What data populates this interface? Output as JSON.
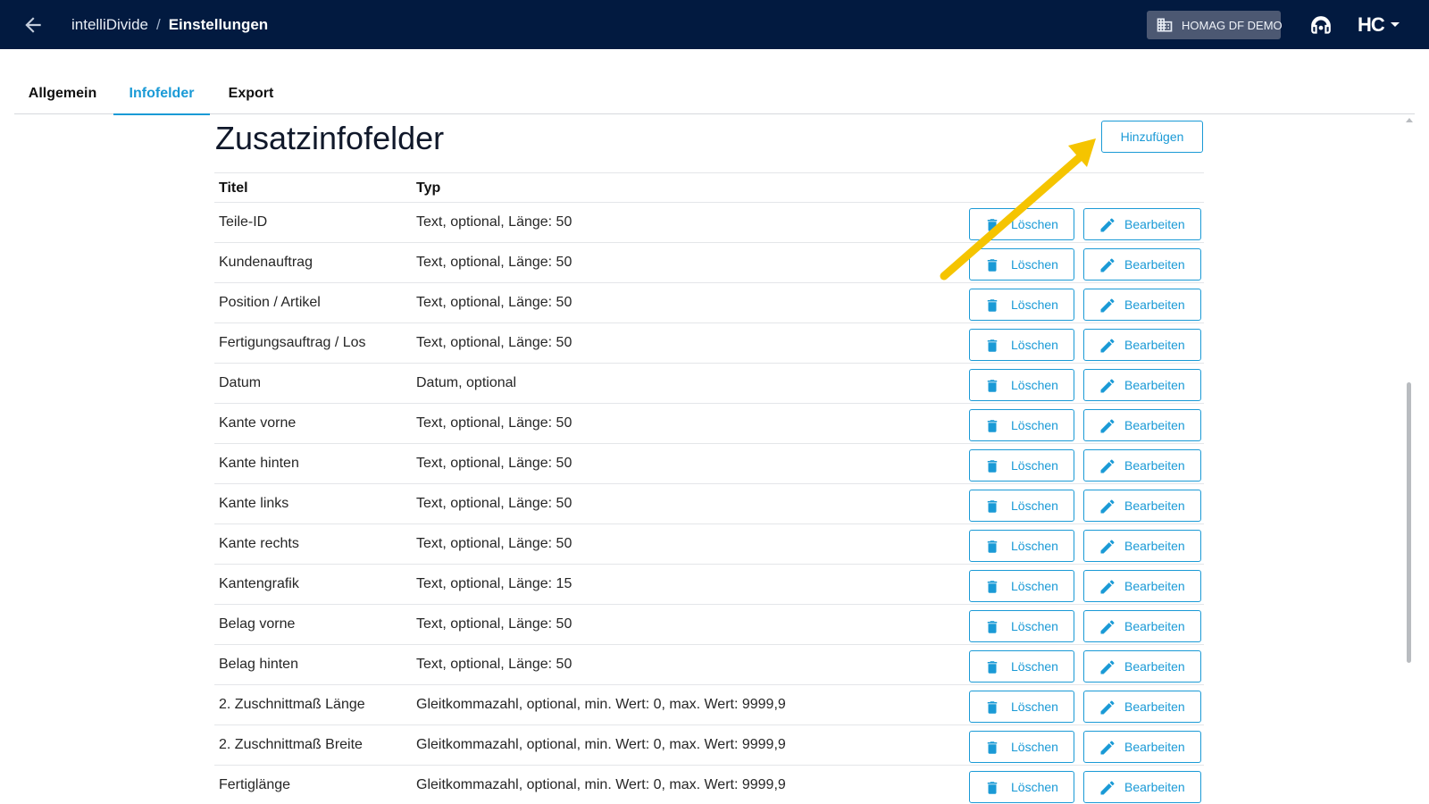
{
  "header": {
    "app_name": "intelliDivide",
    "separator": "/",
    "page_name": "Einstellungen",
    "tenant_label": "HOMAG DF DEMO",
    "app_logo_text": "HC"
  },
  "tabs": [
    {
      "label": "Allgemein",
      "active": false
    },
    {
      "label": "Infofelder",
      "active": true
    },
    {
      "label": "Export",
      "active": false
    }
  ],
  "section": {
    "title": "Zusatzinfofelder",
    "add_label": "Hinzufügen"
  },
  "table": {
    "columns": [
      "Titel",
      "Typ"
    ],
    "delete_label": "Löschen",
    "edit_label": "Bearbeiten",
    "rows": [
      {
        "title": "Teile-ID",
        "type": "Text, optional, Länge: 50"
      },
      {
        "title": "Kundenauftrag",
        "type": "Text, optional, Länge: 50"
      },
      {
        "title": "Position / Artikel",
        "type": "Text, optional, Länge: 50"
      },
      {
        "title": "Fertigungsauftrag / Los",
        "type": "Text, optional, Länge: 50"
      },
      {
        "title": "Datum",
        "type": "Datum, optional"
      },
      {
        "title": "Kante vorne",
        "type": "Text, optional, Länge: 50"
      },
      {
        "title": "Kante hinten",
        "type": "Text, optional, Länge: 50"
      },
      {
        "title": "Kante links",
        "type": "Text, optional, Länge: 50"
      },
      {
        "title": "Kante rechts",
        "type": "Text, optional, Länge: 50"
      },
      {
        "title": "Kantengrafik",
        "type": "Text, optional, Länge: 15"
      },
      {
        "title": "Belag vorne",
        "type": "Text, optional, Länge: 50"
      },
      {
        "title": "Belag hinten",
        "type": "Text, optional, Länge: 50"
      },
      {
        "title": "2. Zuschnittmaß Länge",
        "type": "Gleitkommazahl, optional, min. Wert: 0, max. Wert: 9999,9"
      },
      {
        "title": "2. Zuschnittmaß Breite",
        "type": "Gleitkommazahl, optional, min. Wert: 0, max. Wert: 9999,9"
      },
      {
        "title": "Fertiglänge",
        "type": "Gleitkommazahl, optional, min. Wert: 0, max. Wert: 9999,9"
      }
    ]
  },
  "icons": {
    "back": "arrow-left-icon",
    "tenant": "building-icon",
    "support": "headset-icon",
    "caret": "caret-down-icon",
    "delete": "trash-icon",
    "edit": "pencil-icon"
  },
  "colors": {
    "header_bg": "#021a40",
    "accent": "#1a9ad6",
    "tenant_bg": "#4c5872",
    "annotation_arrow": "#f5c400"
  }
}
